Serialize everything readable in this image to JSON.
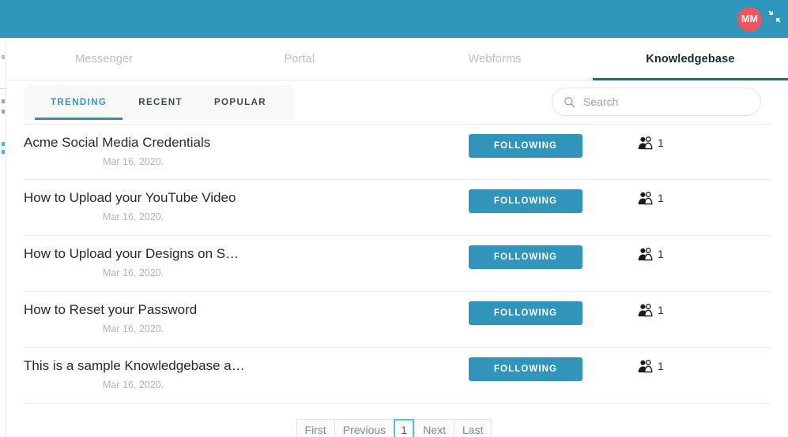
{
  "header": {
    "avatar_initials": "MM",
    "avatar_color": "#f1555a",
    "bar_color": "#2f96bc",
    "collapse_icon": "collapse-arrows-icon"
  },
  "nav": {
    "tabs": [
      {
        "label": "Messenger",
        "active": false
      },
      {
        "label": "Portal",
        "active": false
      },
      {
        "label": "Webforms",
        "active": false
      },
      {
        "label": "Knowledgebase",
        "active": true
      }
    ],
    "active_underline_color": "#1565a8"
  },
  "filters": {
    "tabs": [
      {
        "label": "TRENDING",
        "active": true
      },
      {
        "label": "RECENT",
        "active": false
      },
      {
        "label": "POPULAR",
        "active": false
      }
    ],
    "active_color": "#3d93bb"
  },
  "search": {
    "placeholder": "Search",
    "value": "",
    "icon": "search-icon"
  },
  "list": {
    "follow_label": "FOLLOWING",
    "follow_color": "#3195bb",
    "subscriber_icon": "users-group-icon",
    "rows": [
      {
        "title": "Acme Social Media Credentials",
        "date": "Mar 16, 2020.",
        "follow": "FOLLOWING",
        "count": "1"
      },
      {
        "title": "How to Upload your YouTube Video",
        "date": "Mar 16, 2020.",
        "follow": "FOLLOWING",
        "count": "1"
      },
      {
        "title": "How to Upload your Designs on S…",
        "date": "Mar 16, 2020.",
        "follow": "FOLLOWING",
        "count": "1"
      },
      {
        "title": "How to Reset your Password",
        "date": "Mar 16, 2020.",
        "follow": "FOLLOWING",
        "count": "1"
      },
      {
        "title": "This is a sample Knowledgebase a…",
        "date": "Mar 16, 2020.",
        "follow": "FOLLOWING",
        "count": "1"
      }
    ]
  },
  "pagination": {
    "first": "First",
    "previous": "Previous",
    "current_page": "1",
    "next": "Next",
    "last": "Last",
    "current_border_color": "#4ec3ef"
  }
}
